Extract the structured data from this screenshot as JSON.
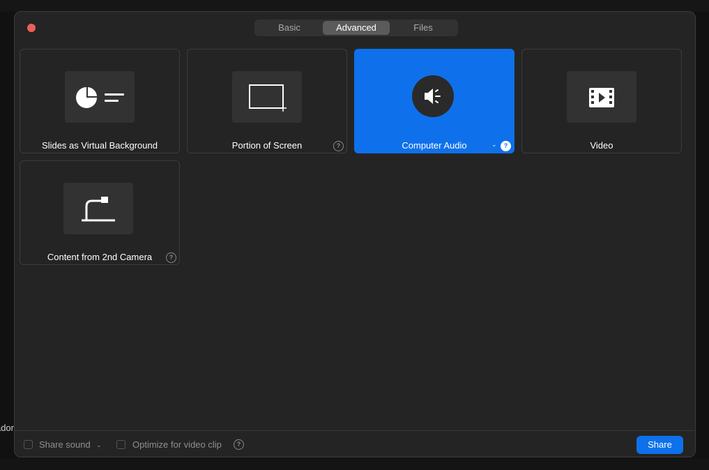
{
  "background": {
    "partial_text": "ador"
  },
  "tabs": [
    {
      "label": "Basic",
      "active": false
    },
    {
      "label": "Advanced",
      "active": true
    },
    {
      "label": "Files",
      "active": false
    }
  ],
  "cards": {
    "slides": {
      "label": "Slides as Virtual Background"
    },
    "portion": {
      "label": "Portion of Screen",
      "help": "?"
    },
    "audio": {
      "label": "Computer Audio",
      "help": "?",
      "selected": true
    },
    "video": {
      "label": "Video"
    },
    "camera": {
      "label": "Content from 2nd Camera",
      "help": "?"
    }
  },
  "footer": {
    "share_sound_label": "Share sound",
    "share_sound_checked": false,
    "optimize_label": "Optimize for video clip",
    "optimize_checked": false,
    "help": "?",
    "share_button_label": "Share"
  },
  "colors": {
    "accent": "#0e71eb",
    "close": "#ec5f59",
    "window_bg": "#242424"
  },
  "icons": {
    "slides": "pie-chart-lines-icon",
    "portion": "selection-rectangle-icon",
    "audio": "speaker-icon",
    "video": "film-strip-icon",
    "camera": "document-camera-icon"
  }
}
